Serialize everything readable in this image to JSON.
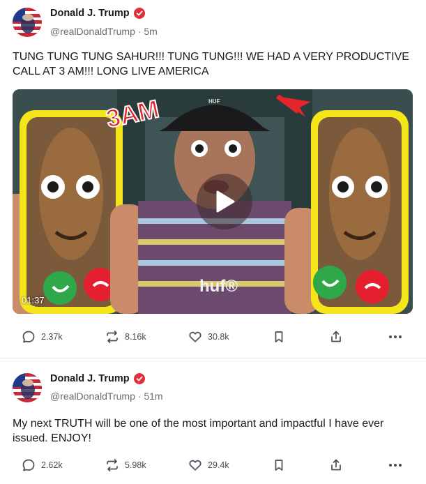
{
  "posts": [
    {
      "author": {
        "name": "Donald J. Trump",
        "handle": "@realDonaldTrump",
        "time": "5m"
      },
      "text": "TUNG TUNG TUNG SAHUR!!! TUNG TUNG!!! WE HAD A VERY PRODUCTIVE CALL AT 3 AM!!! LONG LIVE AMERICA",
      "media": {
        "type": "video",
        "duration": "01:37",
        "thumbnail_text": "3AM",
        "shirt_text": "huf®",
        "cap_text": "HUF"
      },
      "stats": {
        "replies": "2.37k",
        "retruths": "8.16k",
        "likes": "30.8k"
      }
    },
    {
      "author": {
        "name": "Donald J. Trump",
        "handle": "@realDonaldTrump",
        "time": "51m"
      },
      "text": "My next TRUTH will be one of the most important and impactful I have ever issued. ENJOY!",
      "stats": {
        "replies": "2.62k",
        "retruths": "5.98k",
        "likes": "29.4k"
      }
    }
  ],
  "icons": {
    "reply": "reply-icon",
    "retruth": "retruth-icon",
    "like": "heart-icon",
    "bookmark": "bookmark-icon",
    "share": "share-icon",
    "more": "more-icon",
    "verified": "verified-badge-icon",
    "play": "play-icon"
  },
  "colors": {
    "verified": "#e0313a",
    "icon": "#4b4b57",
    "handle": "#6b6b76",
    "divider": "#e3e3e8"
  }
}
